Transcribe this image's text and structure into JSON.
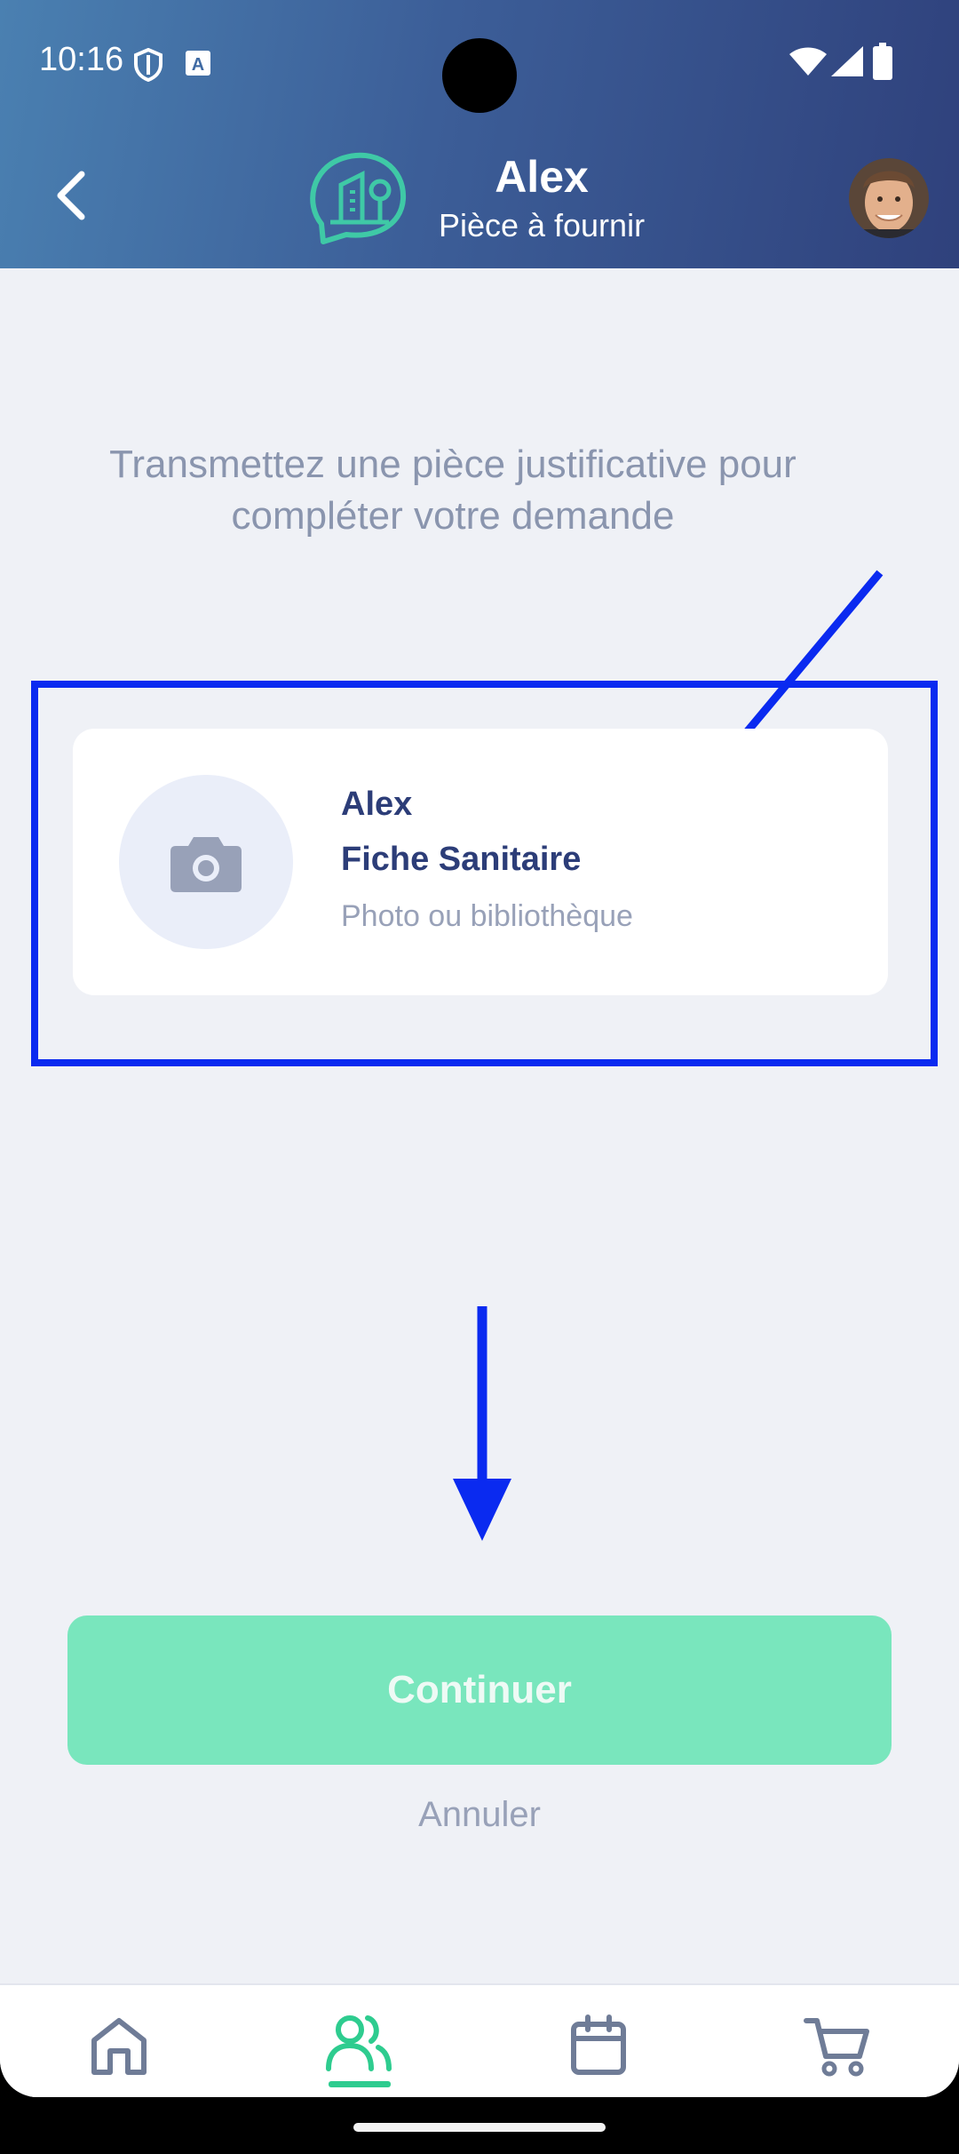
{
  "status_bar": {
    "time": "10:16",
    "icons": [
      "shield-icon",
      "keyboard-a-icon",
      "wifi-icon",
      "signal-icon",
      "battery-icon"
    ]
  },
  "header": {
    "title": "Alex",
    "subtitle": "Pièce à fournir",
    "back_icon": "chevron-left-icon",
    "logo_icon": "building-speech-logo",
    "avatar": "user-avatar"
  },
  "main": {
    "intro_text": "Transmettez une pièce justificative pour compléter votre demande",
    "document_card": {
      "person_name": "Alex",
      "document_name": "Fiche Sanitaire",
      "hint": "Photo ou bibliothèque",
      "icon": "camera-icon"
    },
    "continue_label": "Continuer",
    "cancel_label": "Annuler"
  },
  "bottom_nav": {
    "items": [
      {
        "icon": "home-icon",
        "active": false
      },
      {
        "icon": "users-icon",
        "active": true
      },
      {
        "icon": "calendar-icon",
        "active": false
      },
      {
        "icon": "cart-icon",
        "active": false
      }
    ]
  },
  "colors": {
    "header_start": "#4a80b1",
    "header_end": "#2f417c",
    "accent_green": "#2ecc8f",
    "button_disabled": "#79e6bd",
    "annotation_blue": "#0a2af0",
    "text_navy": "#2c3d78",
    "text_muted": "#98a1b8"
  }
}
